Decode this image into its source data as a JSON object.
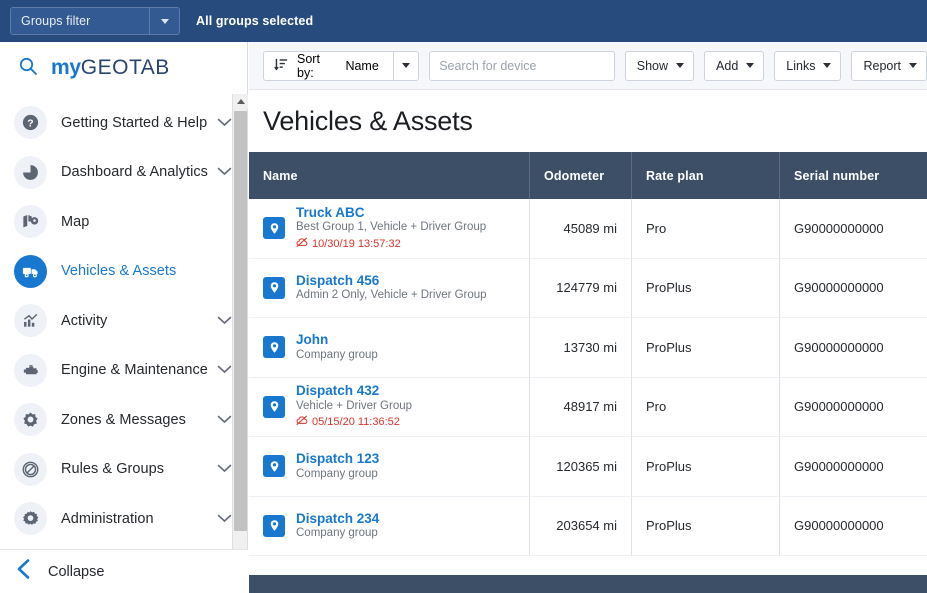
{
  "topbar": {
    "groups_filter_label": "Groups filter",
    "groups_selected_text": "All groups selected"
  },
  "brand": {
    "my": "my",
    "geotab": "GEOTAB"
  },
  "sidebar": {
    "items": [
      {
        "label": "Getting Started & Help",
        "icon": "question-circle-icon",
        "chevron": true,
        "active": false
      },
      {
        "label": "Dashboard & Analytics",
        "icon": "pie-chart-icon",
        "chevron": true,
        "active": false
      },
      {
        "label": "Map",
        "icon": "map-pin-icon",
        "chevron": false,
        "active": false
      },
      {
        "label": "Vehicles & Assets",
        "icon": "truck-icon",
        "chevron": false,
        "active": true
      },
      {
        "label": "Activity",
        "icon": "bar-chart-icon",
        "chevron": true,
        "active": false
      },
      {
        "label": "Engine & Maintenance",
        "icon": "engine-icon",
        "chevron": true,
        "active": false
      },
      {
        "label": "Zones & Messages",
        "icon": "zone-gear-icon",
        "chevron": true,
        "active": false
      },
      {
        "label": "Rules & Groups",
        "icon": "no-entry-icon",
        "chevron": true,
        "active": false
      },
      {
        "label": "Administration",
        "icon": "gear-icon",
        "chevron": true,
        "active": false
      }
    ],
    "collapse_label": "Collapse"
  },
  "toolbar": {
    "sort_by_label": "Sort by:",
    "sort_by_value": "Name",
    "search_placeholder": "Search for device",
    "search_value": "",
    "buttons": [
      {
        "label": "Show"
      },
      {
        "label": "Add"
      },
      {
        "label": "Links"
      },
      {
        "label": "Report"
      }
    ]
  },
  "page": {
    "title": "Vehicles & Assets"
  },
  "table": {
    "columns": [
      "Name",
      "Odometer",
      "Rate plan",
      "Serial number"
    ],
    "rows": [
      {
        "name": "Truck ABC",
        "group": "Best Group 1, Vehicle + Driver Group",
        "offline_timestamp": "10/30/19 13:57:32",
        "odometer": "45089 mi",
        "rate_plan": "Pro",
        "serial_number": "G90000000000"
      },
      {
        "name": "Dispatch 456",
        "group": "Admin 2 Only, Vehicle + Driver Group",
        "offline_timestamp": "",
        "odometer": "124779 mi",
        "rate_plan": "ProPlus",
        "serial_number": "G90000000000"
      },
      {
        "name": "John",
        "group": "Company group",
        "offline_timestamp": "",
        "odometer": "13730 mi",
        "rate_plan": "ProPlus",
        "serial_number": "G90000000000"
      },
      {
        "name": "Dispatch 432",
        "group": "Vehicle + Driver Group",
        "offline_timestamp": "05/15/20 11:36:52",
        "odometer": "48917 mi",
        "rate_plan": "Pro",
        "serial_number": "G90000000000"
      },
      {
        "name": "Dispatch 123",
        "group": "Company group",
        "offline_timestamp": "",
        "odometer": "120365 mi",
        "rate_plan": "ProPlus",
        "serial_number": "G90000000000"
      },
      {
        "name": "Dispatch 234",
        "group": "Company group",
        "offline_timestamp": "",
        "odometer": "203654 mi",
        "rate_plan": "ProPlus",
        "serial_number": "G90000000000"
      }
    ]
  },
  "colors": {
    "topbar_navy": "#274b7d",
    "table_header": "#3c4f66",
    "accent_blue": "#1878cf",
    "offline_red": "#d9342b"
  }
}
